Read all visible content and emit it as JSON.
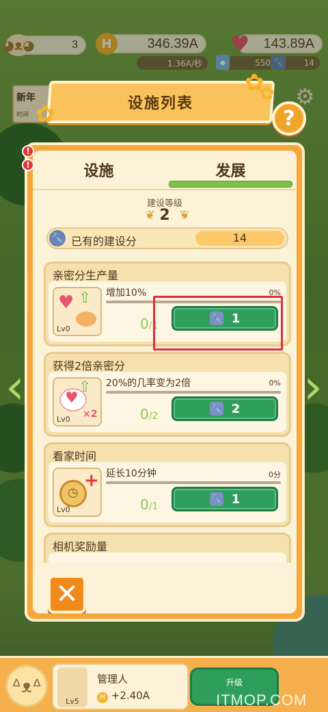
{
  "topbar": {
    "cats": "3",
    "coins": "346.39A",
    "coin_rate": "1.36A/秒",
    "love": "143.89A",
    "gems": "550",
    "wrenches": "14",
    "coin_icon": "H"
  },
  "side_left": {
    "label": "新年",
    "sub": "时间"
  },
  "title": "设施列表",
  "help_label": "?",
  "tabs": [
    {
      "label": "设施",
      "active": false
    },
    {
      "label": "发展",
      "active": true
    }
  ],
  "level": {
    "label": "建设等级",
    "value": "2"
  },
  "points": {
    "label": "已有的建设分",
    "value": "14"
  },
  "items": [
    {
      "title": "亲密分生产量",
      "lv": "Lv0",
      "desc": "增加10%",
      "pct": "0%",
      "have": "0",
      "need": "/1",
      "cost": "1"
    },
    {
      "title": "获得2倍亲密分",
      "lv": "Lv0",
      "desc": "20%的几率变为2倍",
      "pct": "0%",
      "have": "0",
      "need": "/2",
      "cost": "2"
    },
    {
      "title": "看家时间",
      "lv": "Lv0",
      "desc": "延长10分钟",
      "pct": "0分",
      "have": "0",
      "need": "/1",
      "cost": "1"
    },
    {
      "title": "相机奖励量"
    }
  ],
  "close_label": "✕",
  "manager": {
    "name": "管理人",
    "rate": "+2.40A",
    "lv": "Lv5",
    "upgrade_label": "升级"
  },
  "watermark": "ITMOP.COM",
  "colors": {
    "panel": "#f5a73c",
    "button_green": "#2f9e5b",
    "highlight": "#e32a3a"
  }
}
